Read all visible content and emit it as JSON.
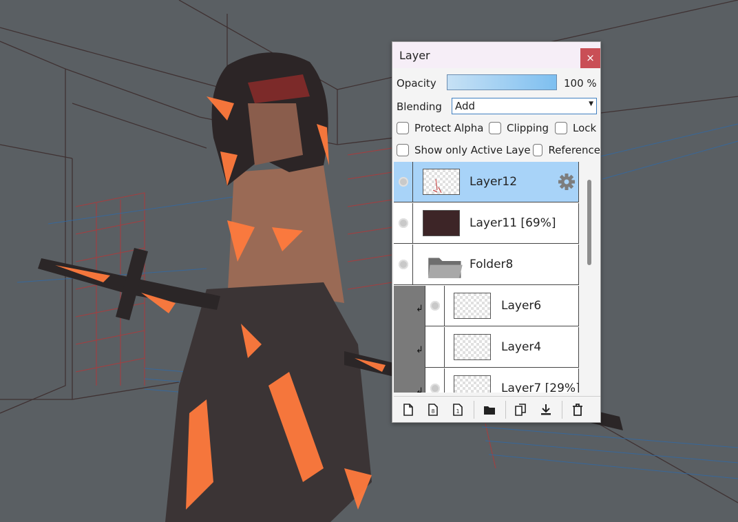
{
  "panel": {
    "title": "Layer",
    "close_glyph": "×",
    "opacity_label": "Opacity",
    "opacity_value": "100 %",
    "opacity_fraction": 1.0,
    "blending_label": "Blending",
    "blending_value": "Add",
    "checkboxes": [
      {
        "label": "Protect Alpha",
        "checked": false
      },
      {
        "label": "Clipping",
        "checked": false
      },
      {
        "label": "Lock",
        "checked": false
      },
      {
        "label": "Show only Active Laye",
        "checked": false
      },
      {
        "label": "Reference",
        "checked": false
      }
    ]
  },
  "layers": [
    {
      "name": "Layer12",
      "visible": true,
      "active": true,
      "thumb": "sketch",
      "icon": "gear-icon"
    },
    {
      "name": "Layer11 [69%]",
      "visible": true,
      "active": false,
      "thumb": "solid",
      "thumb_color": "#3d2527"
    },
    {
      "name": "Folder8",
      "visible": true,
      "active": false,
      "thumb": "folder-icon"
    },
    {
      "name": "Layer6",
      "visible": true,
      "active": false,
      "thumb": "transparent",
      "clipped": true
    },
    {
      "name": "Layer4",
      "visible": false,
      "active": false,
      "thumb": "transparent",
      "clipped": true
    },
    {
      "name": "Layer7 [29%]",
      "visible": true,
      "active": false,
      "thumb": "sketch",
      "clipped": true
    }
  ],
  "toolbar": [
    {
      "name": "new-layer-icon"
    },
    {
      "name": "new-8bit-layer-icon"
    },
    {
      "name": "new-1bit-layer-icon"
    },
    {
      "name": "new-folder-icon"
    },
    {
      "name": "duplicate-layer-icon"
    },
    {
      "name": "merge-down-icon"
    },
    {
      "name": "delete-layer-icon"
    }
  ],
  "colors": {
    "accent": "#a8d3f8",
    "close_button": "#c94f56",
    "canvas_background": "#5a5f63",
    "glow": "#ff7a3d"
  }
}
